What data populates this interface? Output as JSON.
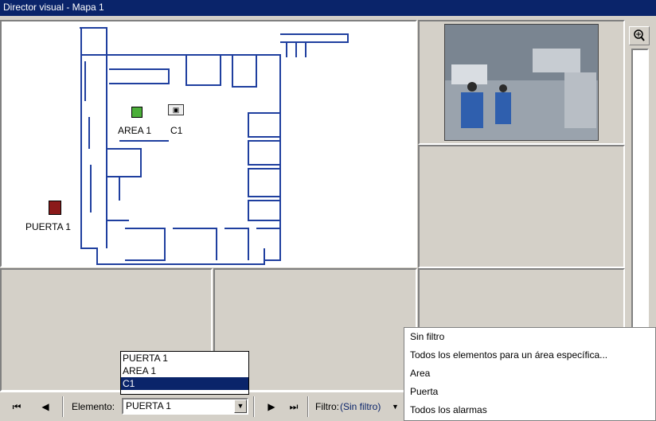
{
  "window": {
    "title": "Director visual - Mapa 1"
  },
  "map": {
    "labels": {
      "area": "AREA 1",
      "camera": "C1",
      "door": "PUERTA 1"
    }
  },
  "toolbar": {
    "first_icon": "first-icon",
    "prev_icon": "prev-icon",
    "next_icon": "next-icon",
    "last_icon": "last-icon",
    "element_label": "Elemento:",
    "element_value": "PUERTA 1",
    "filter_label": "Filtro:",
    "filter_value": "(Sin filtro)"
  },
  "element_dropdown": {
    "items": [
      "PUERTA 1",
      "AREA 1",
      "C1"
    ],
    "selected": "C1"
  },
  "filter_menu": {
    "items": [
      "Sin filtro",
      "Todos los elementos para un área específica...",
      "Area",
      "Puerta",
      "Todos los alarmas"
    ]
  },
  "colors": {
    "title_bar": "#0a246a",
    "map_lines": "#1f3f9f",
    "area_marker": "#4caf3a",
    "door_marker": "#8b1a1a"
  }
}
